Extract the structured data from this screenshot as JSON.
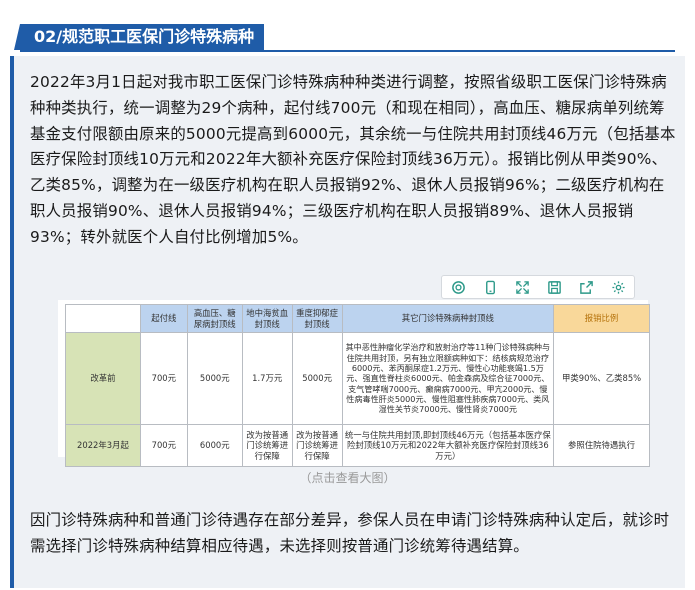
{
  "header": {
    "title": "02/规范职工医保门诊特殊病种"
  },
  "intro": "2022年3月1日起对我市职工医保门诊特殊病种种类进行调整，按照省级职工医保门诊特殊病种种类执行，统一调整为29个病种，起付线700元（和现在相同），高血压、糖尿病单列统筹基金支付限额由原来的5000元提高到6000元，其余统一与住院共用封顶线46万元（包括基本医疗保险封顶线10万元和2022年大额补充医疗保险封顶线36万元）。报销比例从甲类90%、乙类85%，调整为在一级医疗机构在职人员报销92%、退休人员报销96%；二级医疗机构在职人员报销90%、退休人员报销94%；三级医疗机构在职人员报销89%、退休人员报销93%；转外就医个人自付比例增加5%。",
  "toolbar": [
    "search-icon",
    "phone-icon",
    "expand-icon",
    "save-icon",
    "share-icon",
    "settings-icon"
  ],
  "table": {
    "headers": [
      "",
      "起付线",
      "高血压、糖尿病封顶线",
      "地中海贫血封顶线",
      "重度抑郁症封顶线",
      "其它门诊特殊病种封顶线",
      "报销比例"
    ],
    "rows": [
      {
        "label": "改革前",
        "cells": [
          "700元",
          "5000元",
          "1.7万元",
          "5000元",
          "其中恶性肿瘤化学治疗和放射治疗等11种门诊特殊病种与住院共用封顶，另有独立限额病种如下：结核病规范治疗6000元、苯丙酮尿症1.2万元、慢性心功能衰竭1.5万元、强直性脊柱炎6000元、帕金森病及综合征7000元、支气管哮喘7000元、癫痫病7000元、甲亢2000元、慢性病毒性肝炎5000元、慢性阻塞性肺疾病7000元、类风湿性关节炎7000元、慢性肾炎7000元",
          "甲类90%、乙类85%"
        ]
      },
      {
        "label": "2022年3月起",
        "cells": [
          "700元",
          "6000元",
          "改为按普通门诊统筹进行保障",
          "改为按普通门诊统筹进行保障",
          "统一与住院共用封顶,即封顶线46万元（包括基本医疗保险封顶线10万元和2022年大额补充医疗保险封顶线36万元）",
          "参照住院待遇执行"
        ]
      }
    ]
  },
  "caption": "（点击查看大图）",
  "conclusion": "因门诊特殊病种和普通门诊待遇存在部分差异，参保人员在申请门诊特殊病种认定后，就诊时需选择门诊特殊病种结算相应待遇，未选择则按普通门诊统筹待遇结算。",
  "colors": {
    "brand": "#1f5ca8",
    "header_cell": "#bcd3ef",
    "highlight_cell": "#f9d89a",
    "row_label": "#d7e3b6",
    "panel": "#eef1f5"
  }
}
